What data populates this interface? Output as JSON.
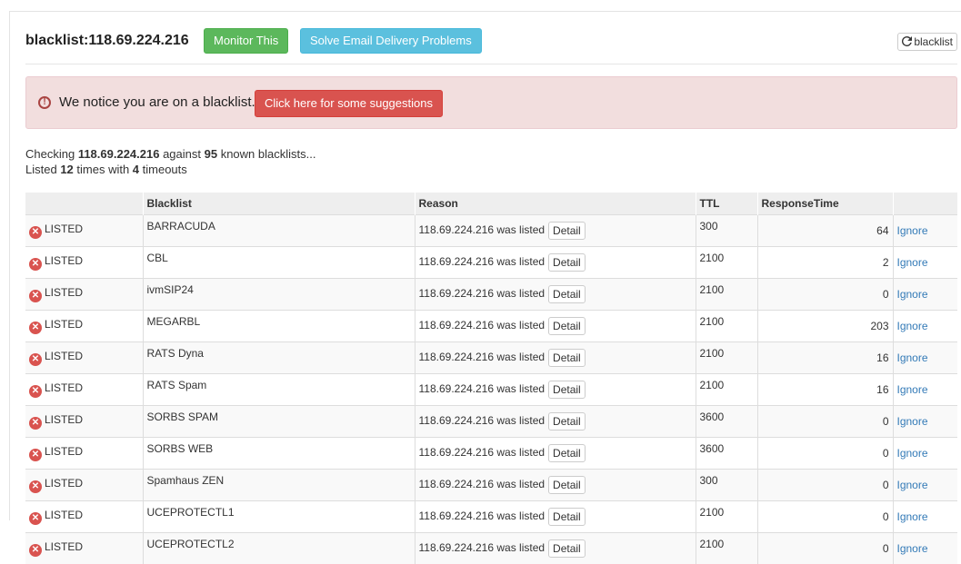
{
  "header": {
    "title": "blacklist:118.69.224.216",
    "monitor_label": "Monitor This",
    "solve_label": "Solve Email Delivery Problems",
    "refresh_icon": "refresh-icon",
    "refresh_label": "blacklist"
  },
  "alert": {
    "icon": "exclamation-circle-icon",
    "text": "We notice you are on a blacklist.",
    "button_label": "Click here for some suggestions"
  },
  "summary": {
    "p1": "Checking ",
    "ip": "118.69.224.216",
    "p2": " against ",
    "count": "95",
    "p3": " known blacklists...",
    "p4": "Listed ",
    "listed": "12",
    "p5": " times with ",
    "timeouts": "4",
    "p6": " timeouts"
  },
  "table": {
    "headers": [
      "",
      "Blacklist",
      "Reason",
      "TTL",
      "ResponseTime",
      ""
    ],
    "rows": [
      {
        "status": "LISTED",
        "blacklist": "BARRACUDA",
        "reason": "118.69.224.216 was listed",
        "detail": "Detail",
        "ttl": "300",
        "response": "64",
        "action": "Ignore"
      },
      {
        "status": "LISTED",
        "blacklist": "CBL",
        "reason": "118.69.224.216 was listed",
        "detail": "Detail",
        "ttl": "2100",
        "response": "2",
        "action": "Ignore"
      },
      {
        "status": "LISTED",
        "blacklist": "ivmSIP24",
        "reason": "118.69.224.216 was listed",
        "detail": "Detail",
        "ttl": "2100",
        "response": "0",
        "action": "Ignore"
      },
      {
        "status": "LISTED",
        "blacklist": "MEGARBL",
        "reason": "118.69.224.216 was listed",
        "detail": "Detail",
        "ttl": "2100",
        "response": "203",
        "action": "Ignore"
      },
      {
        "status": "LISTED",
        "blacklist": "RATS Dyna",
        "reason": "118.69.224.216 was listed",
        "detail": "Detail",
        "ttl": "2100",
        "response": "16",
        "action": "Ignore"
      },
      {
        "status": "LISTED",
        "blacklist": "RATS Spam",
        "reason": "118.69.224.216 was listed",
        "detail": "Detail",
        "ttl": "2100",
        "response": "16",
        "action": "Ignore"
      },
      {
        "status": "LISTED",
        "blacklist": "SORBS SPAM",
        "reason": "118.69.224.216 was listed",
        "detail": "Detail",
        "ttl": "3600",
        "response": "0",
        "action": "Ignore"
      },
      {
        "status": "LISTED",
        "blacklist": "SORBS WEB",
        "reason": "118.69.224.216 was listed",
        "detail": "Detail",
        "ttl": "3600",
        "response": "0",
        "action": "Ignore"
      },
      {
        "status": "LISTED",
        "blacklist": "Spamhaus ZEN",
        "reason": "118.69.224.216 was listed",
        "detail": "Detail",
        "ttl": "300",
        "response": "0",
        "action": "Ignore"
      },
      {
        "status": "LISTED",
        "blacklist": "UCEPROTECTL1",
        "reason": "118.69.224.216 was listed",
        "detail": "Detail",
        "ttl": "2100",
        "response": "0",
        "action": "Ignore"
      },
      {
        "status": "LISTED",
        "blacklist": "UCEPROTECTL2",
        "reason": "118.69.224.216 was listed",
        "detail": "Detail",
        "ttl": "2100",
        "response": "0",
        "action": "Ignore"
      }
    ]
  },
  "colors": {
    "success": "#5cb85c",
    "info": "#5bc0de",
    "danger": "#d9534f",
    "alert_bg": "#f2dede",
    "link": "#337ab7"
  }
}
